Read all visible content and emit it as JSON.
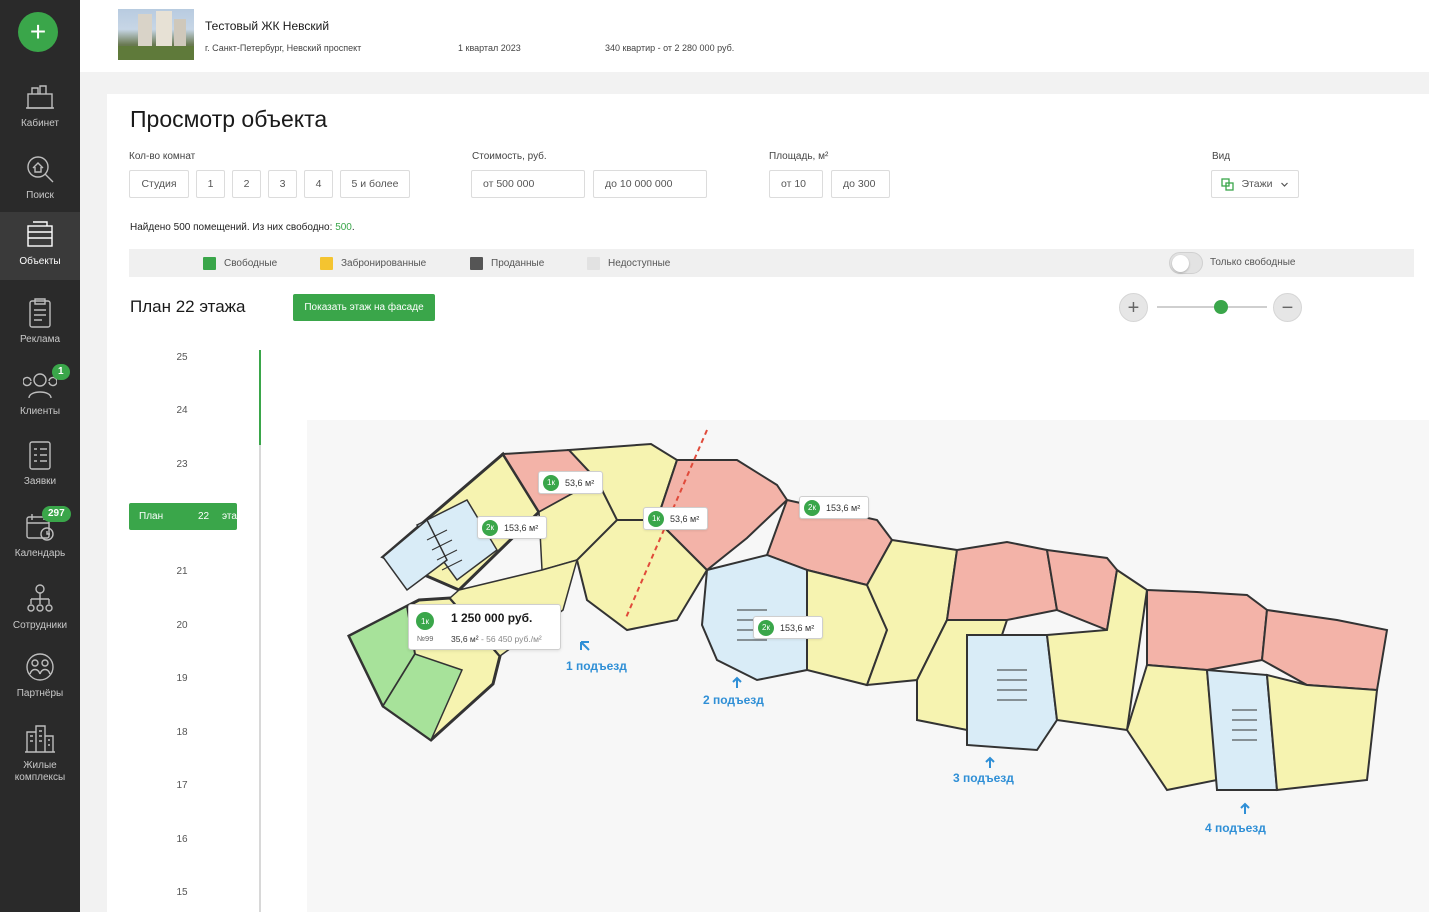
{
  "sidebar": {
    "add_icon": "plus-icon",
    "items": [
      {
        "label": "Кабинет",
        "icon": "cabinet-icon",
        "badge": ""
      },
      {
        "label": "Поиск",
        "icon": "search-house-icon",
        "badge": ""
      },
      {
        "label": "Объекты",
        "icon": "objects-icon",
        "badge": "",
        "active": true
      },
      {
        "label": "Реклама",
        "icon": "clipboard-icon",
        "badge": ""
      },
      {
        "label": "Клиенты",
        "icon": "clients-icon",
        "badge": "1"
      },
      {
        "label": "Заявки",
        "icon": "checklist-icon",
        "badge": ""
      },
      {
        "label": "Календарь",
        "icon": "calendar-icon",
        "badge": "297"
      },
      {
        "label": "Сотрудники",
        "icon": "org-chart-icon",
        "badge": ""
      },
      {
        "label": "Партнёры",
        "icon": "partners-icon",
        "badge": ""
      },
      {
        "label": "Жилые комплексы",
        "icon": "buildings-icon",
        "badge": ""
      }
    ]
  },
  "header": {
    "title": "Тестовый ЖК Невский",
    "address": "г. Санкт-Петербург, Невский проспект",
    "date": "1 квартал 2023",
    "summary": "340 квартир - от 2 280 000 руб."
  },
  "page": {
    "title": "Просмотр объекта"
  },
  "filters": {
    "rooms_label": "Кол-во комнат",
    "rooms": [
      "Студия",
      "1",
      "2",
      "3",
      "4",
      "5 и более"
    ],
    "price_label": "Стоимость, руб.",
    "price_from": "от 500 000",
    "price_to": "до 10 000 000",
    "area_label": "Площадь, м²",
    "area_from": "от 10",
    "area_to": "до 300",
    "view_label": "Вид",
    "view_value": "Этажи"
  },
  "found": {
    "text": "Найдено 500 помещений. Из них свободно: ",
    "free": "500",
    "suffix": "."
  },
  "legend": {
    "items": [
      {
        "label": "Свободные",
        "color": "#3aa64a"
      },
      {
        "label": "Забронированные",
        "color": "#f4c430"
      },
      {
        "label": "Проданные",
        "color": "#555555"
      },
      {
        "label": "Недоступные",
        "color": "#e2e2e2"
      }
    ],
    "toggle_label": "Только свободные",
    "toggle_on": false
  },
  "plan": {
    "title": "План 22 этажа",
    "show_button": "Показать этаж на фасаде",
    "zoom_in": "+",
    "zoom_out": "−",
    "zoom_level": 0.6
  },
  "floors": {
    "numbers": [
      "25",
      "24",
      "23",
      "21",
      "20",
      "19",
      "18",
      "17",
      "16",
      "15"
    ],
    "selected": {
      "prefix": "План",
      "number": "22",
      "suffix": "этажа"
    }
  },
  "markers": [
    {
      "rooms": "1к",
      "area": "53,6 м²"
    },
    {
      "rooms": "2к",
      "area": "153,6 м²"
    },
    {
      "rooms": "1к",
      "area": "53,6 м²"
    },
    {
      "rooms": "2к",
      "area": "153,6 м²"
    },
    {
      "rooms": "2к",
      "area": "153,6 м²"
    }
  ],
  "tooltip": {
    "rooms": "1к",
    "price": "1 250 000 руб.",
    "number": "№99",
    "area": "35,6 м²",
    "price_per_m2": " - 56 450 руб./м²"
  },
  "entrances": [
    "1 подъезд",
    "2 подъезд",
    "3 подъезд",
    "4 подъезд"
  ],
  "colors": {
    "accent": "#3aa64a",
    "free_flat": "#a7e29a",
    "booked_flat": "#f6f3b0",
    "sold_flat": "#f3b3a8",
    "common": "#d9ecf7",
    "entrance_text": "#2f8fd6"
  }
}
